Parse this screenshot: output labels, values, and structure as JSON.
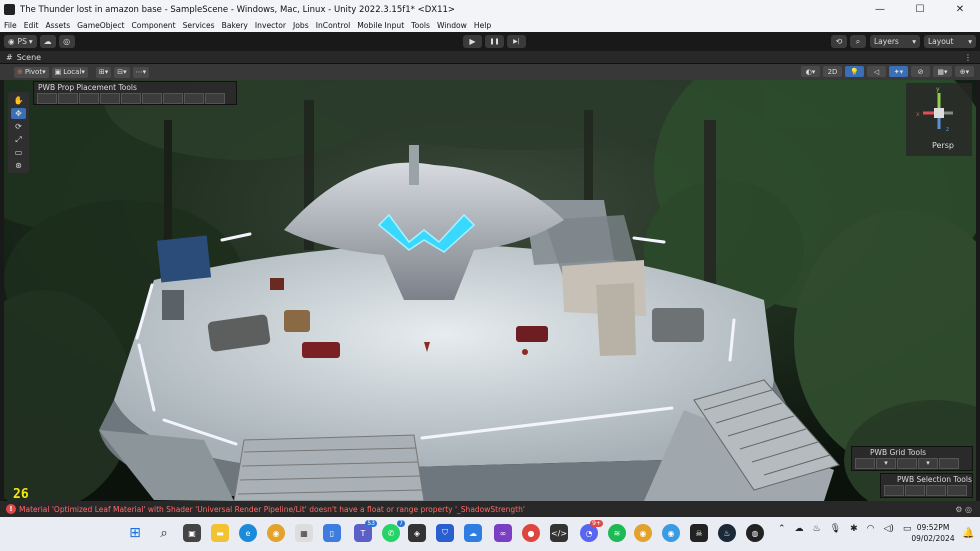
{
  "window": {
    "title": "The Thunder lost in amazon base - SampleScene - Windows, Mac, Linux - Unity 2022.3.15f1* <DX11>",
    "minimize": "—",
    "maximize": "☐",
    "close": "✕"
  },
  "menu": [
    "File",
    "Edit",
    "Assets",
    "GameObject",
    "Component",
    "Services",
    "Bakery",
    "Invector",
    "Jobs",
    "InControl",
    "Mobile Input",
    "Tools",
    "Window",
    "Help"
  ],
  "toolbar": {
    "account": "PS",
    "account_icon": "account-circle-icon",
    "cloud_icon": "cloud-icon",
    "collab_icon": "collab-icon",
    "play_icon": "▶",
    "pause_icon": "❚❚",
    "step_icon": "▶|",
    "layers": "Layers",
    "layout": "Layout"
  },
  "scene_tab": {
    "label": "Scene"
  },
  "scene_tools": {
    "pivot": "Pivot",
    "local": "Local",
    "mode_2d": "2D"
  },
  "pwb": {
    "prop_placement": "PWB Prop Placement Tools",
    "grid_tools": "PWB Grid Tools",
    "selection_tools": "PWB Selection Tools"
  },
  "gizmo": {
    "x": "x",
    "y": "y",
    "z": "z",
    "label": "Persp"
  },
  "fps_counter": "26",
  "status": {
    "message": "Material 'Optimized Leaf Material' with Shader 'Universal Render Pipeline/Lit' doesn't have a float or range property '_ShadowStrength'"
  },
  "taskbar": {
    "badges": {
      "teams": "53",
      "whatsapp": "7",
      "discord": "9+"
    },
    "time": "09:52PM",
    "date": "09/02/2024"
  },
  "colors": {
    "accent_blue": "#3a6fb5",
    "error_red": "#ff6b6b",
    "fps_yellow": "#f5e614",
    "cyan_glow": "#39d9ff"
  }
}
